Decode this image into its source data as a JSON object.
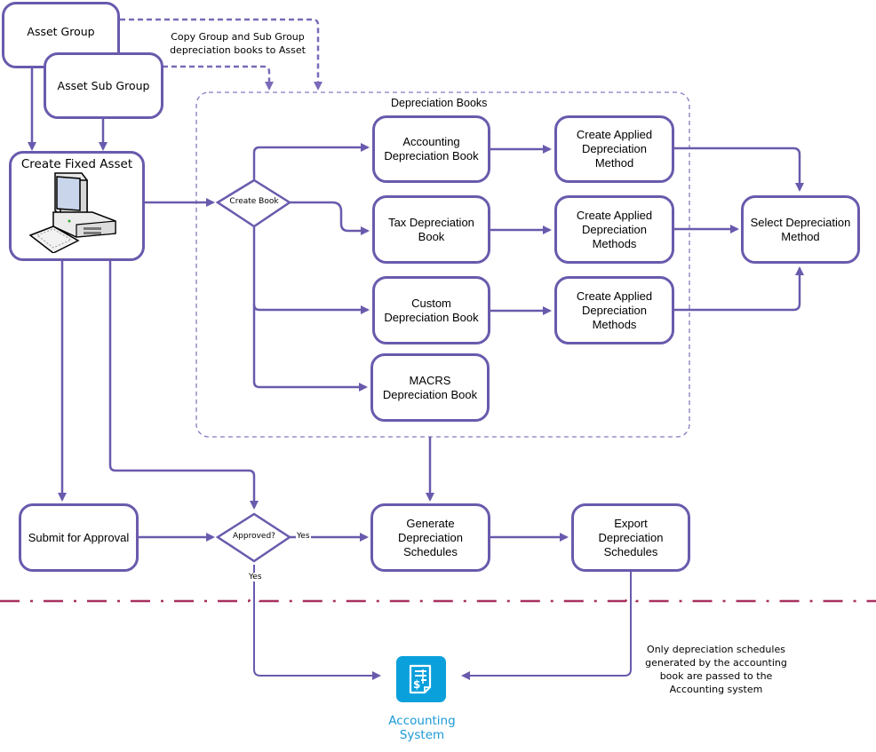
{
  "colors": {
    "connector": "#6a5aad",
    "dashed_group": "#8878c0",
    "boundary_line": "#a8305f",
    "accounting_icon": "#0aa0dc",
    "accounting_label": "#1b9ad6"
  },
  "nodes": {
    "asset_group": "Asset Group",
    "asset_sub_group": "Asset Sub Group",
    "create_fixed_asset": "Create Fixed Asset",
    "accounting_book": "Accounting\nDepreciation Book",
    "tax_book": "Tax Depreciation\nBook",
    "custom_book": "Custom\nDepreciation Book",
    "macrs_book": "MACRS\nDepreciation Book",
    "applied_method_1": "Create Applied\nDepreciation\nMethod",
    "applied_method_2": "Create Applied\nDepreciation\nMethods",
    "applied_method_3": "Create Applied\nDepreciation\nMethods",
    "select_method": "Select Depreciation\nMethod",
    "submit_approval": "Submit for Approval",
    "generate_schedules": "Generate\nDepreciation\nSchedules",
    "export_schedules": "Export\nDepreciation\nSchedules"
  },
  "decisions": {
    "create_book": "Create Book",
    "approved": "Approved?"
  },
  "edge_labels": {
    "approved_yes_right": "Yes",
    "approved_yes_down": "Yes"
  },
  "group": {
    "label": "Depreciation Books"
  },
  "notes": {
    "copy_books": "Copy Group and Sub Group\ndepreciation books to Asset",
    "accounting_only": "Only depreciation schedules\ngenerated by the accounting\nbook are passed to the\nAccounting system"
  },
  "external_system": {
    "icon": "invoice-dollar-icon",
    "label": "Accounting\nSystem"
  },
  "icons": {
    "create_fixed_asset": "desktop-computer-icon"
  }
}
